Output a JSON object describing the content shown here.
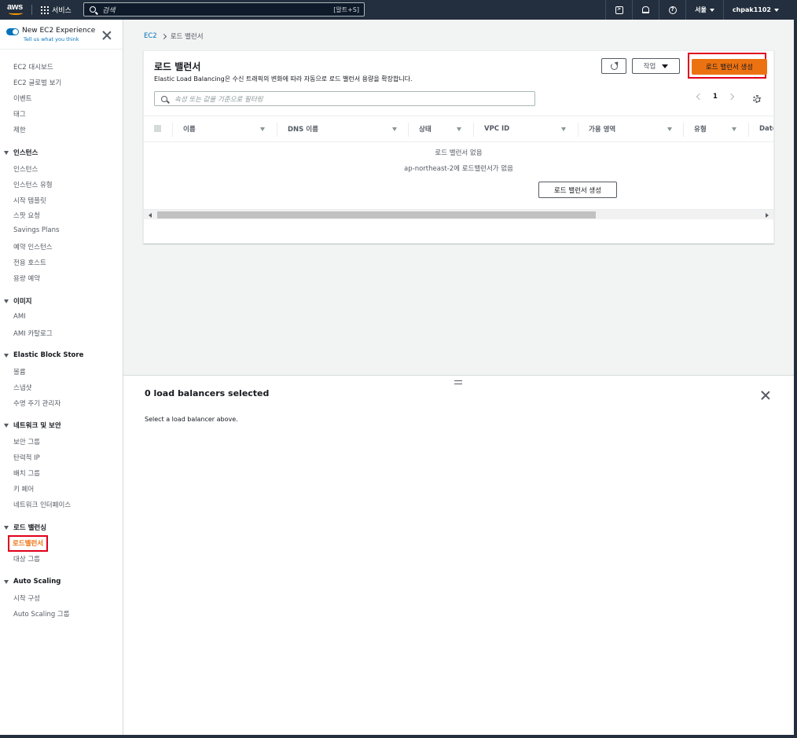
{
  "topnav": {
    "logo_text": "aws",
    "services_label": "서비스",
    "search_placeholder": "검색",
    "search_shortcut": "[알트+S]",
    "region": "서울",
    "account": "chpak1102",
    "icons": [
      "cloudshell-icon",
      "bell-icon",
      "help-icon"
    ]
  },
  "sidebar": {
    "experience_title": "New EC2 Experience",
    "experience_sub": "Tell us what you think",
    "top_items": [
      "EC2 대시보드",
      "EC2 글로벌 보기",
      "이벤트",
      "태그",
      "제한"
    ],
    "sections": [
      {
        "title": "인스턴스",
        "items": [
          "인스턴스",
          "인스턴스 유형",
          "시작 템플릿",
          "스팟 요청",
          "Savings Plans",
          "예약 인스턴스",
          "전용 호스트",
          "용량 예약"
        ]
      },
      {
        "title": "이미지",
        "items": [
          "AMI",
          "AMI 카탈로그"
        ]
      },
      {
        "title": "Elastic Block Store",
        "items": [
          "볼륨",
          "스냅샷",
          "수명 주기 관리자"
        ]
      },
      {
        "title": "네트워크 및 보안",
        "items": [
          "보안 그룹",
          "탄력적 IP",
          "배치 그룹",
          "키 페어",
          "네트워크 인터페이스"
        ]
      },
      {
        "title": "로드 밸런싱",
        "items": [
          "로드밸런서",
          "대상 그룹"
        ]
      },
      {
        "title": "Auto Scaling",
        "items": [
          "시작 구성",
          "Auto Scaling 그룹"
        ]
      }
    ],
    "active_item": "로드밸런서"
  },
  "breadcrumb": {
    "root": "EC2",
    "current": "로드 밸런서"
  },
  "panel": {
    "title": "로드 밸런서",
    "description": "Elastic Load Balancing은 수신 트래픽의 변화에 따라 자동으로 로드 밸런서 용량을 확장합니다.",
    "actions_label": "작업",
    "create_label": "로드 밸런서 생성",
    "filter_placeholder": "속성 또는 값을 기준으로 필터링",
    "page_number": "1",
    "columns": [
      "이름",
      "DNS 이름",
      "상태",
      "VPC ID",
      "가용 영역",
      "유형",
      "Date"
    ],
    "empty_title": "로드 밸런서 없음",
    "empty_desc": "ap-northeast-2에 로드밸런서가 없음",
    "empty_button": "로드 밸런서 생성"
  },
  "split": {
    "title": "0 load balancers selected",
    "body": "Select a load balancer above."
  },
  "colors": {
    "nav_bg": "#232f3e",
    "accent": "#ec7211",
    "link": "#0073bb",
    "highlight_box": "#e0001b"
  }
}
